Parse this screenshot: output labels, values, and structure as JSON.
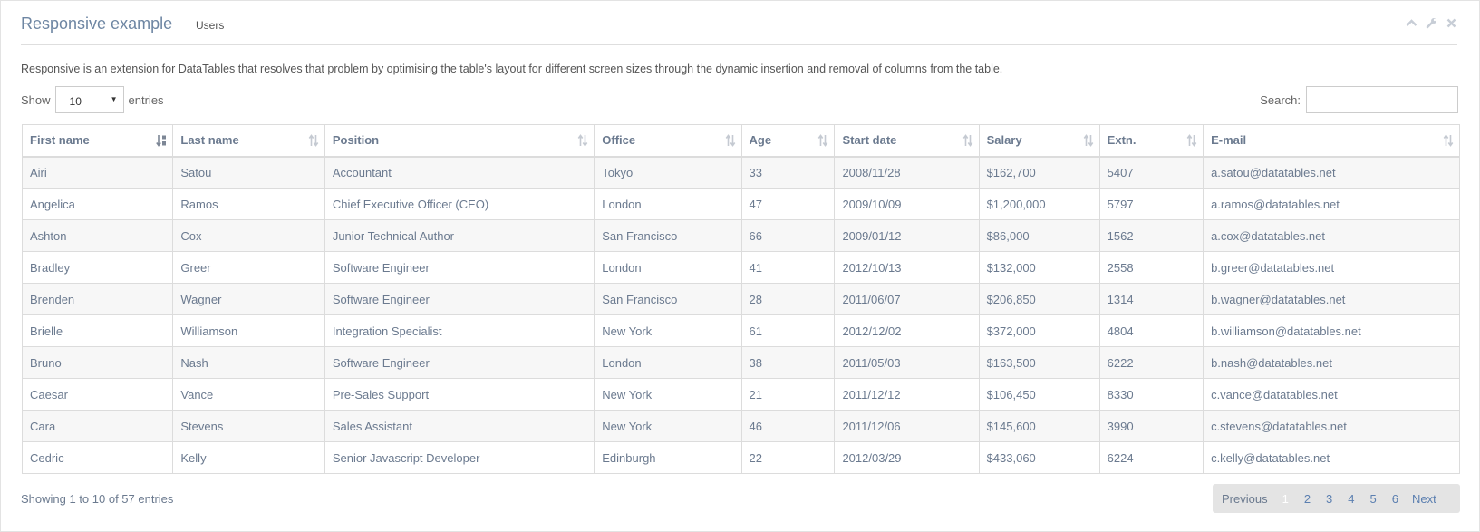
{
  "widget": {
    "title": "Responsive example",
    "subtitle": "Users"
  },
  "description": "Responsive is an extension for DataTables that resolves that problem by optimising the table's layout for different screen sizes through the dynamic insertion and removal of columns from the table.",
  "length": {
    "show_label": "Show",
    "value": "10",
    "entries_label": "entries"
  },
  "search": {
    "label": "Search:",
    "value": ""
  },
  "table": {
    "columns": [
      "First name",
      "Last name",
      "Position",
      "Office",
      "Age",
      "Start date",
      "Salary",
      "Extn.",
      "E-mail"
    ],
    "rows": [
      [
        "Airi",
        "Satou",
        "Accountant",
        "Tokyo",
        "33",
        "2008/11/28",
        "$162,700",
        "5407",
        "a.satou@datatables.net"
      ],
      [
        "Angelica",
        "Ramos",
        "Chief Executive Officer (CEO)",
        "London",
        "47",
        "2009/10/09",
        "$1,200,000",
        "5797",
        "a.ramos@datatables.net"
      ],
      [
        "Ashton",
        "Cox",
        "Junior Technical Author",
        "San Francisco",
        "66",
        "2009/01/12",
        "$86,000",
        "1562",
        "a.cox@datatables.net"
      ],
      [
        "Bradley",
        "Greer",
        "Software Engineer",
        "London",
        "41",
        "2012/10/13",
        "$132,000",
        "2558",
        "b.greer@datatables.net"
      ],
      [
        "Brenden",
        "Wagner",
        "Software Engineer",
        "San Francisco",
        "28",
        "2011/06/07",
        "$206,850",
        "1314",
        "b.wagner@datatables.net"
      ],
      [
        "Brielle",
        "Williamson",
        "Integration Specialist",
        "New York",
        "61",
        "2012/12/02",
        "$372,000",
        "4804",
        "b.williamson@datatables.net"
      ],
      [
        "Bruno",
        "Nash",
        "Software Engineer",
        "London",
        "38",
        "2011/05/03",
        "$163,500",
        "6222",
        "b.nash@datatables.net"
      ],
      [
        "Caesar",
        "Vance",
        "Pre-Sales Support",
        "New York",
        "21",
        "2011/12/12",
        "$106,450",
        "8330",
        "c.vance@datatables.net"
      ],
      [
        "Cara",
        "Stevens",
        "Sales Assistant",
        "New York",
        "46",
        "2011/12/06",
        "$145,600",
        "3990",
        "c.stevens@datatables.net"
      ],
      [
        "Cedric",
        "Kelly",
        "Senior Javascript Developer",
        "Edinburgh",
        "22",
        "2012/03/29",
        "$433,060",
        "6224",
        "c.kelly@datatables.net"
      ]
    ]
  },
  "info": "Showing 1 to 10 of 57 entries",
  "pagination": {
    "previous": "Previous",
    "pages": [
      "1",
      "2",
      "3",
      "4",
      "5",
      "6"
    ],
    "current": "1",
    "next": "Next"
  },
  "icons": {
    "collapse": "chevron-up-icon",
    "settings": "wrench-icon",
    "close": "close-icon",
    "sort": "sort-icon",
    "sort_active": "sort-alpha-asc-icon"
  }
}
